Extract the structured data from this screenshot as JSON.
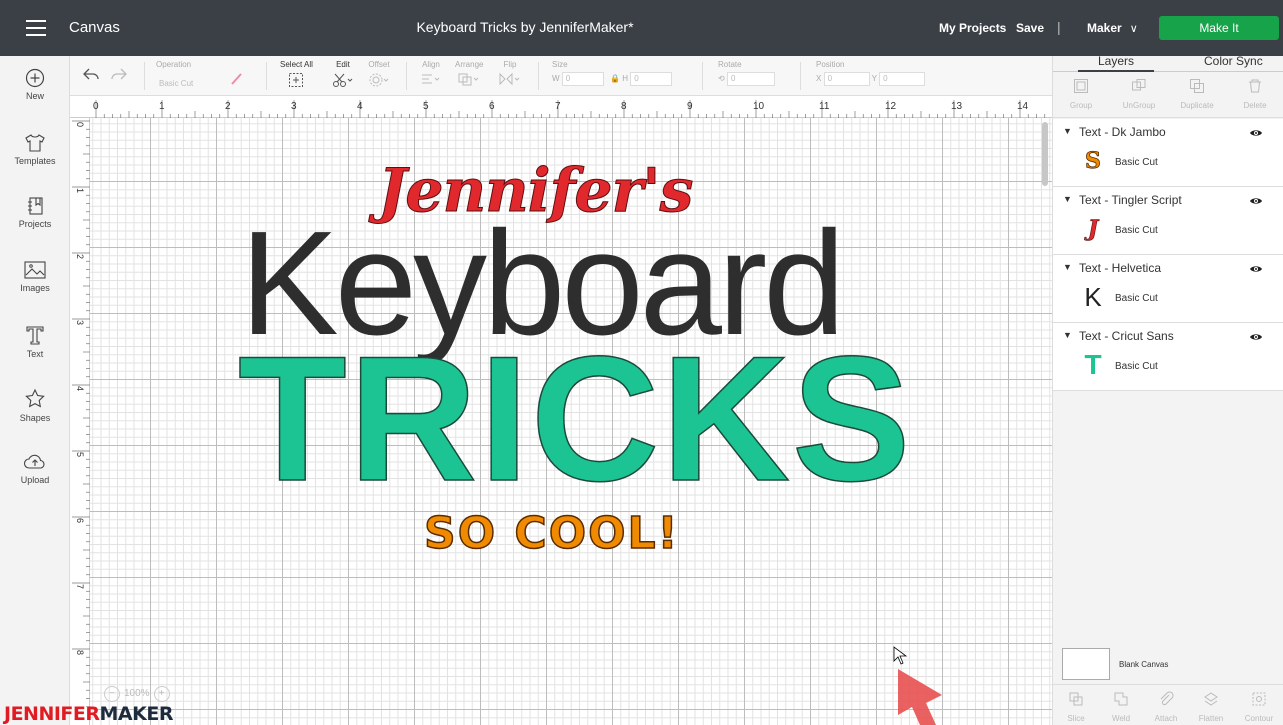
{
  "header": {
    "app_title": "Canvas",
    "doc_title": "Keyboard Tricks by JenniferMaker*",
    "my_projects": "My Projects",
    "save": "Save",
    "separator": "|",
    "machine": "Maker",
    "make_it": "Make It"
  },
  "left_rail": {
    "items": [
      {
        "label": "New",
        "icon": "plus-circle-icon"
      },
      {
        "label": "Templates",
        "icon": "tshirt-icon"
      },
      {
        "label": "Projects",
        "icon": "projects-icon"
      },
      {
        "label": "Images",
        "icon": "image-icon"
      },
      {
        "label": "Text",
        "icon": "text-icon"
      },
      {
        "label": "Shapes",
        "icon": "shapes-icon"
      },
      {
        "label": "Upload",
        "icon": "upload-icon"
      }
    ]
  },
  "toolbar": {
    "operation_label": "Operation",
    "operation_value": "Basic Cut",
    "select_all": "Select All",
    "edit": "Edit",
    "offset": "Offset",
    "align": "Align",
    "arrange": "Arrange",
    "flip": "Flip",
    "size": "Size",
    "size_w": "W",
    "size_w_value": "0",
    "size_h": "H",
    "size_h_value": "0",
    "rotate": "Rotate",
    "rotate_value": "0",
    "position": "Position",
    "pos_x": "X",
    "pos_x_value": "0",
    "pos_y": "Y",
    "pos_y_value": "0"
  },
  "ruler": {
    "top": [
      "0",
      "1",
      "2",
      "3",
      "4",
      "5",
      "6",
      "7",
      "8",
      "9",
      "10",
      "11",
      "12",
      "13",
      "14"
    ],
    "left": [
      "0",
      "1",
      "2",
      "3",
      "4",
      "5",
      "6",
      "7",
      "8"
    ]
  },
  "canvas": {
    "texts": [
      {
        "text": "Jennifer's",
        "color": "#e0282d"
      },
      {
        "text": "Keyboard",
        "color": "#2e2e2e"
      },
      {
        "text": "TRICKS",
        "color": "#1cc494"
      },
      {
        "text": "SO COOL!",
        "color": "#f08a00"
      }
    ],
    "zoom": "100%"
  },
  "watermark": {
    "part1": "JENNIFER",
    "part2": "MAKER"
  },
  "right_panel": {
    "tabs": [
      "Layers",
      "Color Sync"
    ],
    "actions": [
      "Group",
      "UnGroup",
      "Duplicate",
      "Delete"
    ],
    "layers": [
      {
        "name": "Text - Dk Jambo",
        "thumb": "S",
        "thumb_color": "#f08a00",
        "operation": "Basic Cut"
      },
      {
        "name": "Text - Tingler Script",
        "thumb": "J",
        "thumb_color": "#e0282d",
        "operation": "Basic Cut"
      },
      {
        "name": "Text - Helvetica",
        "thumb": "K",
        "thumb_color": "#222222",
        "operation": "Basic Cut"
      },
      {
        "name": "Text - Cricut Sans",
        "thumb": "T",
        "thumb_color": "#1cc494",
        "operation": "Basic Cut"
      }
    ],
    "blank_canvas": "Blank Canvas",
    "bottom_actions": [
      "Slice",
      "Weld",
      "Attach",
      "Flatten",
      "Contour"
    ]
  }
}
